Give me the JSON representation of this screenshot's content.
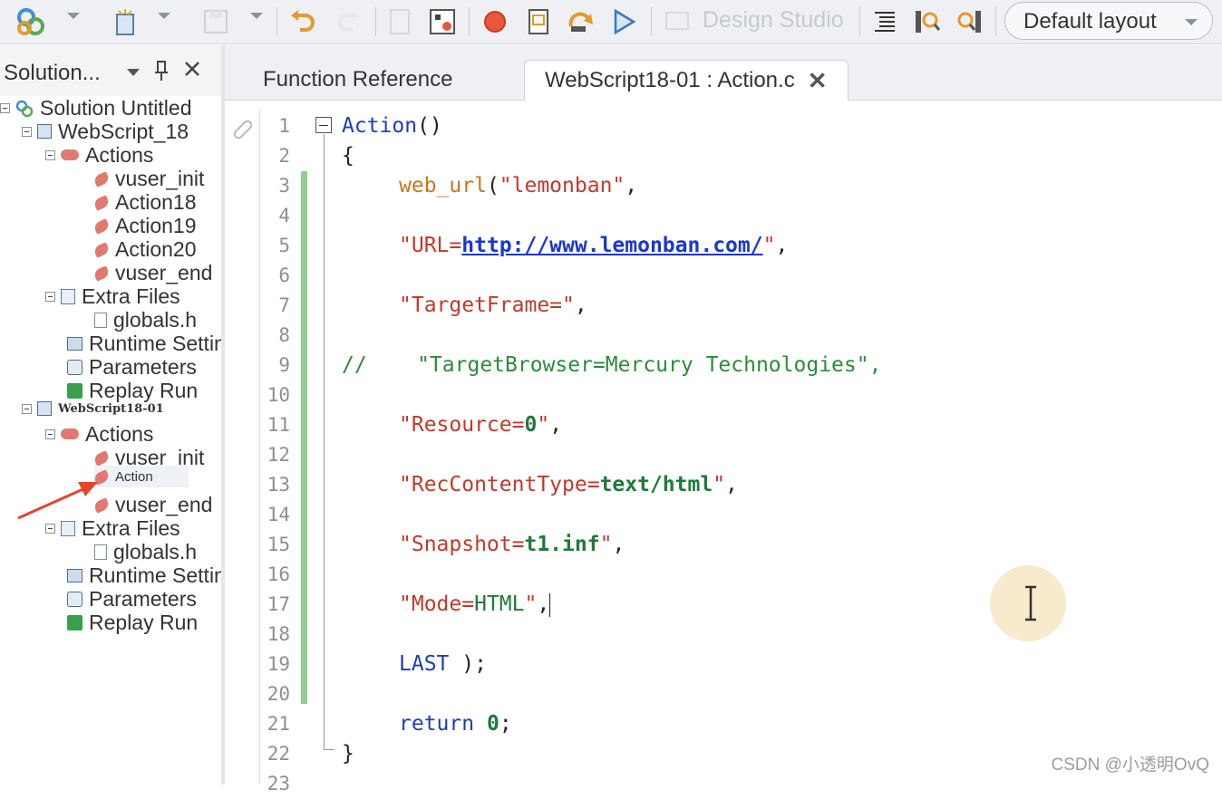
{
  "toolbar": {
    "design_studio_label": "Design Studio",
    "layout_select_value": "Default layout",
    "icons": [
      "solution-icon",
      "new-script-icon",
      "save-icon",
      "undo-icon",
      "redo-icon",
      "compile-icon",
      "run-settings-icon",
      "record-icon",
      "script-view-icon",
      "replay-step-icon",
      "run-icon",
      "design-studio-icon",
      "align-icon",
      "find-icon",
      "find-next-icon"
    ]
  },
  "solution_explorer": {
    "title": "Solution...",
    "items": [
      {
        "label": "Solution Untitled",
        "icon": "solution-icon"
      },
      {
        "label": "WebScript_18",
        "icon": "script-icon"
      },
      {
        "label": "Actions",
        "icon": "actions-icon"
      },
      {
        "label": "vuser_init",
        "icon": "action-icon"
      },
      {
        "label": "Action18",
        "icon": "action-icon"
      },
      {
        "label": "Action19",
        "icon": "action-icon"
      },
      {
        "label": "Action20",
        "icon": "action-icon"
      },
      {
        "label": "vuser_end",
        "icon": "action-icon"
      },
      {
        "label": "Extra Files",
        "icon": "files-icon"
      },
      {
        "label": "globals.h",
        "icon": "file-icon"
      },
      {
        "label": "Runtime Settings",
        "icon": "runtime-icon"
      },
      {
        "label": "Parameters",
        "icon": "parameters-icon"
      },
      {
        "label": "Replay Run",
        "icon": "replay-icon"
      },
      {
        "label": "WebScript18-01",
        "icon": "script-icon"
      },
      {
        "label": "Actions",
        "icon": "actions-icon"
      },
      {
        "label": "vuser_init",
        "icon": "action-icon"
      },
      {
        "label": "Action",
        "icon": "action-icon"
      },
      {
        "label": "vuser_end",
        "icon": "action-icon"
      },
      {
        "label": "Extra Files",
        "icon": "files-icon"
      },
      {
        "label": "globals.h",
        "icon": "file-icon"
      },
      {
        "label": "Runtime Settings",
        "icon": "runtime-icon"
      },
      {
        "label": "Parameters",
        "icon": "parameters-icon"
      },
      {
        "label": "Replay Run",
        "icon": "replay-icon"
      }
    ]
  },
  "tabs": [
    {
      "label": "Function Reference"
    },
    {
      "label": "WebScript18-01 : Action.c"
    }
  ],
  "editor": {
    "line_numbers": [
      "1",
      "2",
      "3",
      "4",
      "5",
      "6",
      "7",
      "8",
      "9",
      "10",
      "11",
      "12",
      "13",
      "14",
      "15",
      "16",
      "17",
      "18",
      "19",
      "20",
      "21",
      "22",
      "23"
    ],
    "code": {
      "l1_name": "Action",
      "l1_parens": "()",
      "l2": "{",
      "l3_fn": "web_url",
      "l3_open": "(",
      "l3_str": "\"lemonban\"",
      "l3_comma": ",",
      "l5_q1": "\"URL=",
      "l5_url": "http://www.lemonban.com/",
      "l5_q2": "\"",
      "l5_comma": ",",
      "l7_str": "\"TargetFrame=\"",
      "l7_comma": ",",
      "l9_comment": "//    \"TargetBrowser=Mercury Technologies\",",
      "l11_key": "\"Resource=",
      "l11_val": "0",
      "l11_q": "\"",
      "l11_comma": ",",
      "l13_key": "\"RecContentType=",
      "l13_val": "text/html",
      "l13_q": "\"",
      "l13_comma": ",",
      "l15_key": "\"Snapshot=",
      "l15_val": "t1.inf",
      "l15_q": "\"",
      "l15_comma": ",",
      "l17_key": "\"Mode=",
      "l17_val": "HTML",
      "l17_q": "\"",
      "l17_comma": ",",
      "l19_kw": "LAST",
      "l19_rest": " );",
      "l21_kw": "return",
      "l21_sp": " ",
      "l21_val": "0",
      "l21_semi": ";",
      "l22": "}"
    }
  },
  "watermark": "CSDN @小透明OvQ",
  "colors": {
    "keyword": "#1e3db8",
    "function": "#c9761c",
    "string": "#c0392b",
    "value": "#1f7a3a",
    "comment": "#2c8b3a",
    "change_bar": "#8fd08f",
    "annotation_arrow": "#e5452f"
  }
}
